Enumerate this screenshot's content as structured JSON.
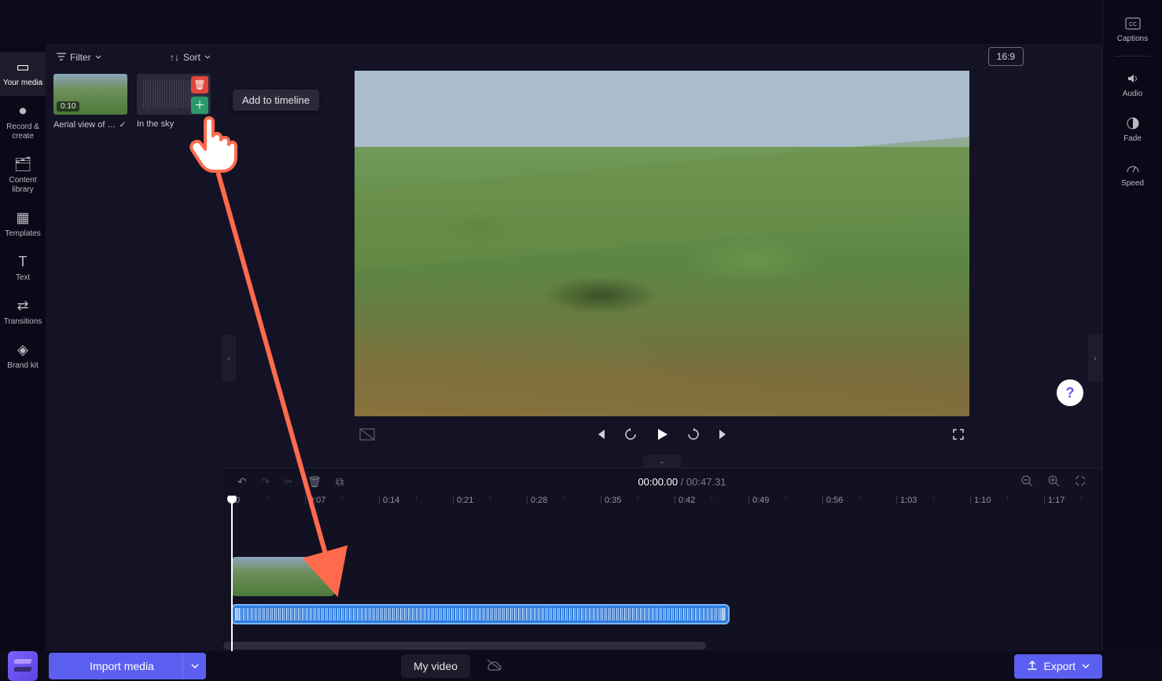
{
  "header": {
    "import_label": "Import media",
    "title": "My video",
    "export_label": "Export"
  },
  "left_nav": [
    {
      "label": "Your media"
    },
    {
      "label": "Record & create"
    },
    {
      "label": "Content library"
    },
    {
      "label": "Templates"
    },
    {
      "label": "Text"
    },
    {
      "label": "Transitions"
    },
    {
      "label": "Brand kit"
    }
  ],
  "right_nav": [
    {
      "label": "Captions"
    },
    {
      "label": "Audio"
    },
    {
      "label": "Fade"
    },
    {
      "label": "Speed"
    }
  ],
  "media_panel": {
    "filter_label": "Filter",
    "sort_label": "Sort",
    "items": [
      {
        "name": "Aerial view of …",
        "duration": "0:10",
        "checked": true
      },
      {
        "name": "In the sky"
      }
    ]
  },
  "tooltip": "Add to timeline",
  "preview": {
    "aspect_badge": "16:9"
  },
  "timeline": {
    "current": "00:00.00",
    "total": "00:47.31",
    "ticks": [
      "0",
      "0:07",
      "0:14",
      "0:21",
      "0:28",
      "0:35",
      "0:42",
      "0:49",
      "0:56",
      "1:03",
      "1:10",
      "1:17"
    ]
  }
}
